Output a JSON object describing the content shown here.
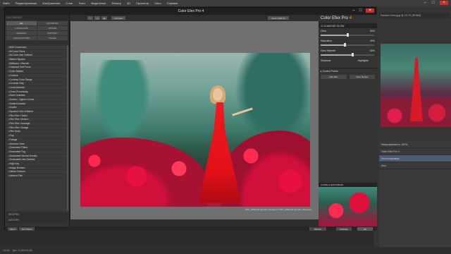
{
  "photoshop": {
    "menu": [
      "Файл",
      "Редактирование",
      "Изображение",
      "Слои",
      "Текст",
      "Выделение",
      "Фильтр",
      "3D",
      "Просмотр",
      "Окно",
      "Справка"
    ],
    "doc_tab": "Fashion Dress.jpg @ 16,7% (RGB/8)",
    "layers": [
      "Непрозрачность: 100%",
      "Color Efex Pro 4",
      "Фон копировать",
      "Фон"
    ],
    "status": "Док: 11,8M/16,0M",
    "zoom": "16,6%"
  },
  "cep": {
    "title": "Color Efex Pro 4",
    "version": "1.0 / 2.5.0.117",
    "categories": [
      "ALL",
      "FAVORITES",
      "LANDSCAPE",
      "NATURE",
      "WEDDING",
      "PORTRAIT",
      "ARCHITECTURE",
      "TRAVEL"
    ],
    "filters": [
      "B/W Conversion",
      "Bi-Color Filters",
      "Bi-Color User Defined",
      "Bleach Bypass",
      "Brilliance / Warmth",
      "Classical Soft Focus",
      "Color Stylizer",
      "Colorize",
      "Contrast Color Range",
      "Contrast Only",
      "Cross Balance",
      "Cross Processing",
      "Dark Contrasts",
      "Darken / Lighten Center",
      "Detail Extractor",
      "Duplex",
      "Dynamic Skin Softener",
      "Film Efex: Faded",
      "Film Efex: Modern",
      "Film Efex: Nostalgic",
      "Film Efex: Vintage",
      "Film Grain",
      "Fog",
      "Foliage",
      "Glamour Glow",
      "Graduated Filters",
      "Graduated Fog",
      "Graduated Neutral Density",
      "Graduated User Defined",
      "High Key",
      "Image Borders",
      "Indian Summer",
      "Infrared Film"
    ],
    "left_bottom": [
      "RECIPES",
      "HISTORY"
    ],
    "compare_label": "Compare",
    "zoom_label": "Zoom (100 %)",
    "caption": "DSC_4939 как сделать объемн.2 / DSC_4939 как сделать объемн.2",
    "brand_name": "Color Efex Pro",
    "brand_version": "4",
    "filter_header": "GLAMOUR GLOW",
    "sliders": [
      {
        "label": "Glow",
        "value": "50%",
        "fraction": 0.5
      },
      {
        "label": "Saturation",
        "value": "45%",
        "fraction": 0.45
      },
      {
        "label": "Glow Warmth",
        "value": "60%",
        "fraction": 0.6
      }
    ],
    "shadows_label": "Shadows",
    "highlights_label": "Highlights",
    "control_points_label": "Control Points",
    "add_filter_label": "Add Filter",
    "save_recipe_label": "Save Recipe",
    "loupe_label": "LOUPE & HISTOGRAM",
    "help_label": "HELP",
    "settings_label": "SETTINGS",
    "brush_label": "BRUSH",
    "cancel_label": "CANCEL",
    "ok_label": "OK"
  }
}
